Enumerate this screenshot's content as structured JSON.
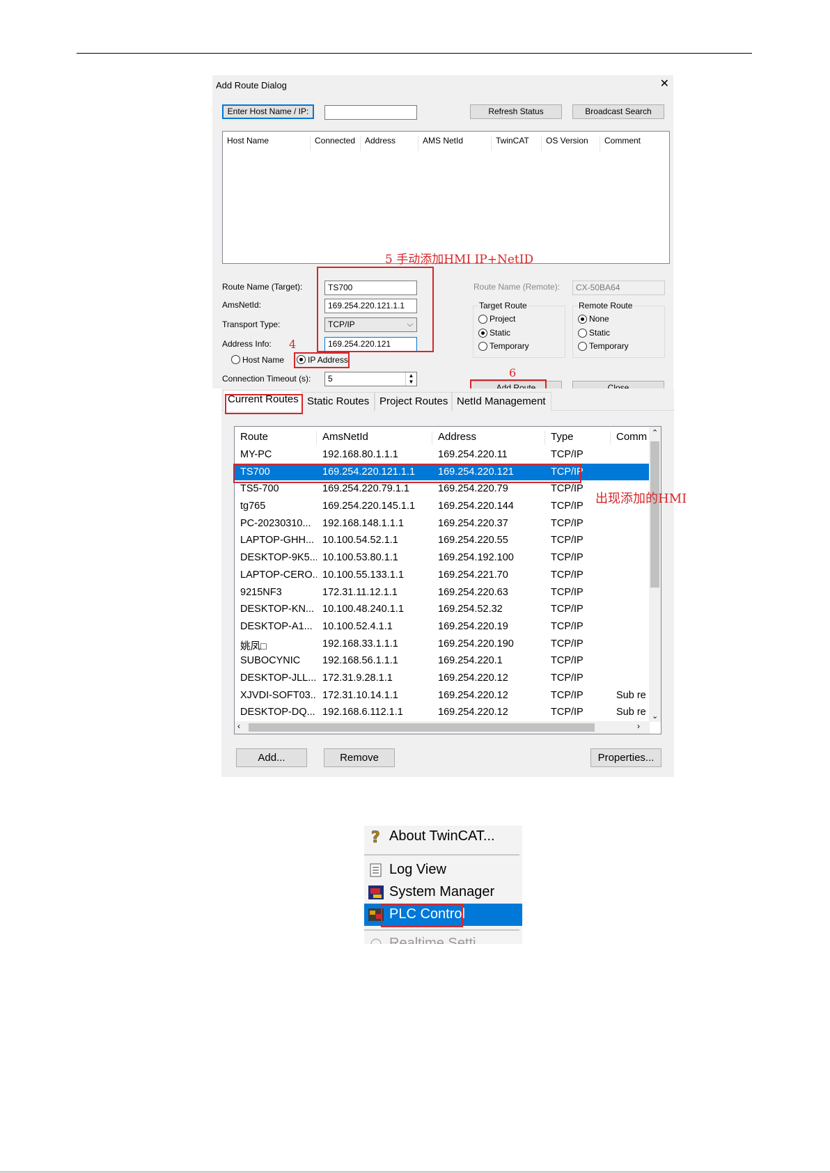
{
  "dialog": {
    "title": "Add Route Dialog",
    "close_glyph": "✕",
    "enter_host_button": "Enter Host Name / IP:",
    "host_input_value": "",
    "refresh_button": "Refresh Status",
    "broadcast_button": "Broadcast Search",
    "list_columns": [
      "Host Name",
      "Connected",
      "Address",
      "AMS NetId",
      "TwinCAT",
      "OS Version",
      "Comment"
    ],
    "route_name_target_label": "Route Name (Target):",
    "route_name_target_value": "TS700",
    "amsnetid_label": "AmsNetId:",
    "amsnetid_value": "169.254.220.121.1.1",
    "transport_label": "Transport Type:",
    "transport_value": "TCP/IP",
    "address_info_label": "Address Info:",
    "address_info_value": "169.254.220.121",
    "host_name_radio": "Host Name",
    "ip_address_radio": "IP Address",
    "timeout_label": "Connection Timeout (s):",
    "timeout_value": "5",
    "route_name_remote_label": "Route Name (Remote):",
    "route_name_remote_value": "CX-50BA64",
    "target_route": {
      "title": "Target Route",
      "options": [
        "Project",
        "Static",
        "Temporary"
      ],
      "selected": "Static"
    },
    "remote_route": {
      "title": "Remote Route",
      "options": [
        "None",
        "Static",
        "Temporary"
      ],
      "selected": "None"
    },
    "add_route_button": "Add Route",
    "close_button": "Close"
  },
  "annotations": {
    "step5": "5 手动添加HMI IP+NetID",
    "step4": "4",
    "step6": "6",
    "result_note": "出现添加的HMI"
  },
  "routes_panel": {
    "tabs": [
      "Current Routes",
      "Static Routes",
      "Project Routes",
      "NetId Management"
    ],
    "active_tab": "Current Routes",
    "columns": [
      "Route",
      "AmsNetId",
      "Address",
      "Type",
      "Comm"
    ],
    "rows": [
      {
        "route": "MY-PC",
        "amsnetid": "192.168.80.1.1.1",
        "address": "169.254.220.11",
        "type": "TCP/IP",
        "comment": ""
      },
      {
        "route": "TS700",
        "amsnetid": "169.254.220.121.1.1",
        "address": "169.254.220.121",
        "type": "TCP/IP",
        "comment": ""
      },
      {
        "route": "TS5-700",
        "amsnetid": "169.254.220.79.1.1",
        "address": "169.254.220.79",
        "type": "TCP/IP",
        "comment": ""
      },
      {
        "route": "tg765",
        "amsnetid": "169.254.220.145.1.1",
        "address": "169.254.220.144",
        "type": "TCP/IP",
        "comment": ""
      },
      {
        "route": "PC-20230310...",
        "amsnetid": "192.168.148.1.1.1",
        "address": "169.254.220.37",
        "type": "TCP/IP",
        "comment": ""
      },
      {
        "route": "LAPTOP-GHH...",
        "amsnetid": "10.100.54.52.1.1",
        "address": "169.254.220.55",
        "type": "TCP/IP",
        "comment": ""
      },
      {
        "route": "DESKTOP-9K5...",
        "amsnetid": "10.100.53.80.1.1",
        "address": "169.254.192.100",
        "type": "TCP/IP",
        "comment": ""
      },
      {
        "route": "LAPTOP-CERO...",
        "amsnetid": "10.100.55.133.1.1",
        "address": "169.254.221.70",
        "type": "TCP/IP",
        "comment": ""
      },
      {
        "route": "9215NF3",
        "amsnetid": "172.31.11.12.1.1",
        "address": "169.254.220.63",
        "type": "TCP/IP",
        "comment": ""
      },
      {
        "route": "DESKTOP-KN...",
        "amsnetid": "10.100.48.240.1.1",
        "address": "169.254.52.32",
        "type": "TCP/IP",
        "comment": ""
      },
      {
        "route": "DESKTOP-A1...",
        "amsnetid": "10.100.52.4.1.1",
        "address": "169.254.220.19",
        "type": "TCP/IP",
        "comment": ""
      },
      {
        "route": "姚凤□",
        "amsnetid": "192.168.33.1.1.1",
        "address": "169.254.220.190",
        "type": "TCP/IP",
        "comment": ""
      },
      {
        "route": "SUBOCYNIC",
        "amsnetid": "192.168.56.1.1.1",
        "address": "169.254.220.1",
        "type": "TCP/IP",
        "comment": ""
      },
      {
        "route": "DESKTOP-JLL...",
        "amsnetid": "172.31.9.28.1.1",
        "address": "169.254.220.12",
        "type": "TCP/IP",
        "comment": ""
      },
      {
        "route": "XJVDI-SOFT03...",
        "amsnetid": "172.31.10.14.1.1",
        "address": "169.254.220.12",
        "type": "TCP/IP",
        "comment": "Sub re"
      },
      {
        "route": "DESKTOP-DQ...",
        "amsnetid": "192.168.6.112.1.1",
        "address": "169.254.220.12",
        "type": "TCP/IP",
        "comment": "Sub re"
      }
    ],
    "selected_row": "TS700",
    "add_button": "Add...",
    "remove_button": "Remove",
    "properties_button": "Properties..."
  },
  "menu": {
    "items": [
      {
        "label": "About TwinCAT...",
        "icon": "question-icon"
      },
      {
        "label": "Log View",
        "icon": "log-icon"
      },
      {
        "label": "System Manager",
        "icon": "system-manager-icon"
      },
      {
        "label": "PLC Control",
        "icon": "plc-icon"
      },
      {
        "label": "Realtime Setti...",
        "icon": "realtime-icon"
      }
    ],
    "selected": "PLC Control"
  },
  "colors": {
    "selection": "#0078d7",
    "annotation_red": "#d6262b"
  }
}
